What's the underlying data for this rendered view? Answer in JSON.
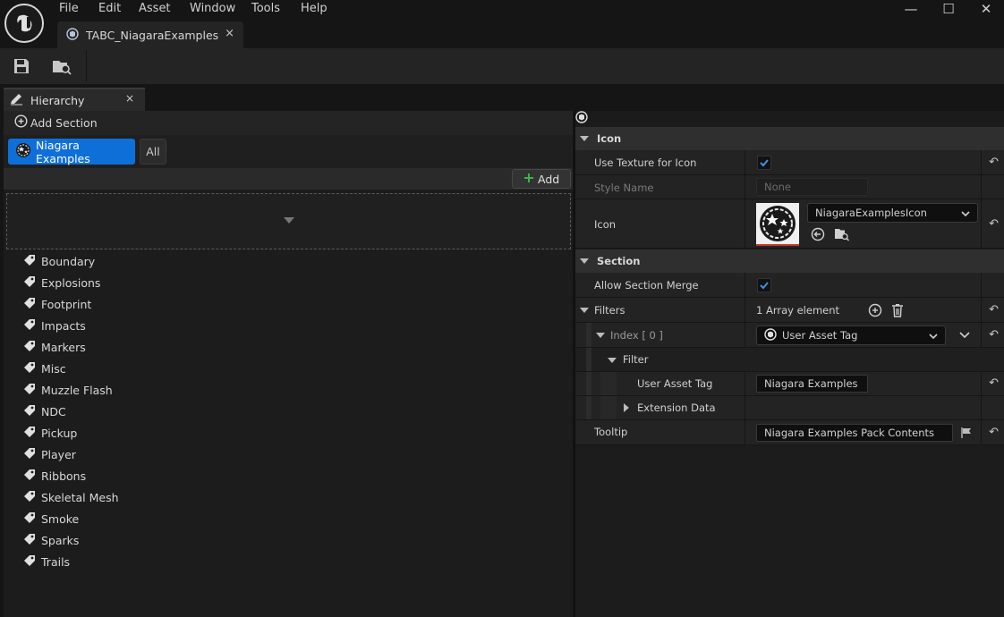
{
  "menu": [
    "File",
    "Edit",
    "Asset",
    "Window",
    "Tools",
    "Help"
  ],
  "window_controls": {
    "minimize": "—",
    "maximize": "☐",
    "close": "✕"
  },
  "doc_tab": {
    "label": "TABC_NiagaraExamples",
    "close": "×"
  },
  "panel_tab": {
    "label": "Hierarchy",
    "close": "×"
  },
  "hierarchy": {
    "add_section_label": "Add Section",
    "sections": [
      "Niagara Examples",
      "All"
    ],
    "add_button_label": "Add",
    "categories": [
      "Boundary",
      "Explosions",
      "Footprint",
      "Impacts",
      "Markers",
      "Misc",
      "Muzzle Flash",
      "NDC",
      "Pickup",
      "Player",
      "Ribbons",
      "Skeletal Mesh",
      "Smoke",
      "Sparks",
      "Trails"
    ]
  },
  "details": {
    "icon_category": "Icon",
    "use_texture_label": "Use Texture for Icon",
    "use_texture_checked": true,
    "style_name_label": "Style Name",
    "style_name_value": "None",
    "icon_label": "Icon",
    "icon_asset": "NiagaraExamplesIcon",
    "section_category": "Section",
    "allow_merge_label": "Allow Section Merge",
    "allow_merge_checked": true,
    "filters_label": "Filters",
    "filters_count": "1 Array element",
    "index_label": "Index [ 0 ]",
    "index_value": "User Asset Tag",
    "filter_label": "Filter",
    "user_asset_tag_label": "User Asset Tag",
    "user_asset_tag_value": "Niagara Examples",
    "extension_data_label": "Extension Data",
    "tooltip_label": "Tooltip",
    "tooltip_value": "Niagara Examples Pack Contents"
  },
  "colors": {
    "accent": "#0e6fd9",
    "background": "#151515",
    "panel": "#1c1c1c"
  }
}
